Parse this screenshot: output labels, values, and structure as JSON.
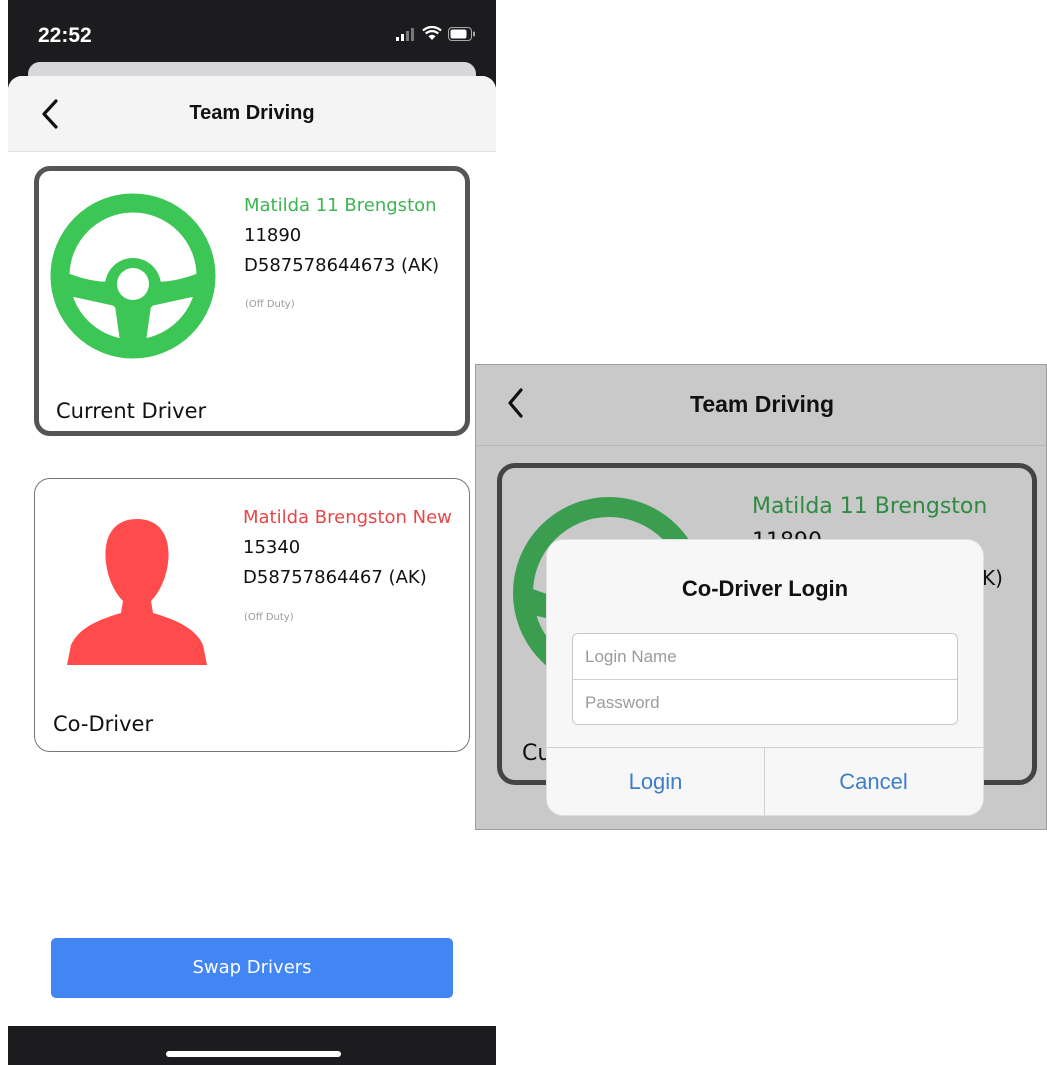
{
  "status_bar": {
    "time": "22:52"
  },
  "header": {
    "title": "Team Driving"
  },
  "current_driver": {
    "name": "Matilda 11 Brengston",
    "id": "11890",
    "license": "D587578644673 (AK)",
    "status": "(Off Duty)",
    "label": "Current Driver",
    "name_color": "#3cb552",
    "icon": "steering-wheel-icon"
  },
  "co_driver": {
    "name": "Matilda Brengston New",
    "id": "15340",
    "license": "D58757864467 (AK)",
    "status": "(Off Duty)",
    "label": "Co-Driver",
    "name_color": "#e54848",
    "icon": "person-silhouette-icon"
  },
  "swap_button": {
    "label": "Swap Drivers",
    "color": "#4285f4"
  },
  "zoom_view": {
    "header_title": "Team Driving",
    "driver_name": "Matilda 11 Brengston",
    "driver_id_partial": "11890",
    "license_fragment": "K)",
    "label_fragment": "Cu"
  },
  "login_dialog": {
    "title": "Co-Driver Login",
    "login_name_placeholder": "Login Name",
    "password_placeholder": "Password",
    "login_label": "Login",
    "cancel_label": "Cancel",
    "accent_color": "#3d7dc9"
  }
}
